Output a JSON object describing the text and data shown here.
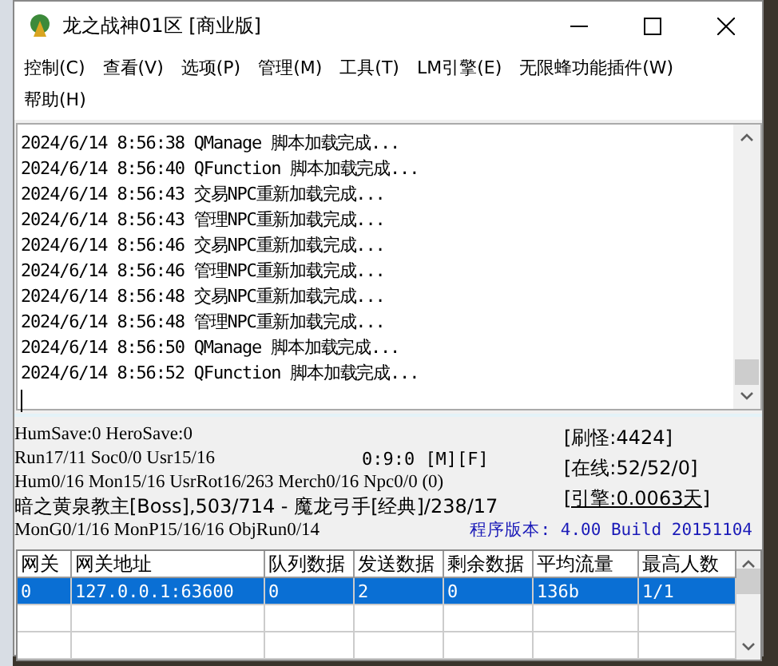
{
  "window": {
    "title": "龙之战神01区 [商业版]"
  },
  "menu": [
    "控制(C)",
    "查看(V)",
    "选项(P)",
    "管理(M)",
    "工具(T)",
    "LM引擎(E)",
    "无限蜂功能插件(W)",
    "帮助(H)"
  ],
  "log": [
    "2024/6/14 8:56:38 QManage 脚本加载完成...",
    "2024/6/14 8:56:40 QFunction 脚本加载完成...",
    "2024/6/14 8:56:43 交易NPC重新加载完成...",
    "2024/6/14 8:56:43 管理NPC重新加载完成...",
    "2024/6/14 8:56:46 交易NPC重新加载完成...",
    "2024/6/14 8:56:46 管理NPC重新加载完成...",
    "2024/6/14 8:56:48 交易NPC重新加载完成...",
    "2024/6/14 8:56:48 管理NPC重新加载完成...",
    "2024/6/14 8:56:50 QManage 脚本加载完成...",
    "2024/6/14 8:56:52 QFunction 脚本加载完成..."
  ],
  "status": {
    "lines": [
      "HumSave:0 HeroSave:0",
      "Run17/11 Soc0/0 Usr15/16",
      "Hum0/16 Mon15/16 UsrRot16/263 Merch0/16 Npc0/0 (0)",
      "暗之黄泉教主[Boss],503/714 - 魔龙弓手[经典]/238/17",
      "MonG0/1/16 MonP15/16/16 ObjRun0/14"
    ],
    "clock": "0:9:0 [M][F]",
    "counters": [
      {
        "text": "[刷怪:4424]",
        "kind": "plain"
      },
      {
        "text": "[在线:52/52/0]",
        "kind": "plain"
      },
      {
        "text": "[引擎:0.0063天]",
        "kind": "link"
      }
    ],
    "version": "程序版本: 4.00 Build 20151104"
  },
  "table": {
    "columns": [
      "网关",
      "网关地址",
      "队列数据",
      "发送数据",
      "剩余数据",
      "平均流量",
      "最高人数"
    ],
    "rows": [
      {
        "cells": [
          "0",
          "127.0.0.1:63600",
          "0",
          "2",
          "0",
          "136b",
          "1/1"
        ],
        "selected": true
      }
    ]
  }
}
